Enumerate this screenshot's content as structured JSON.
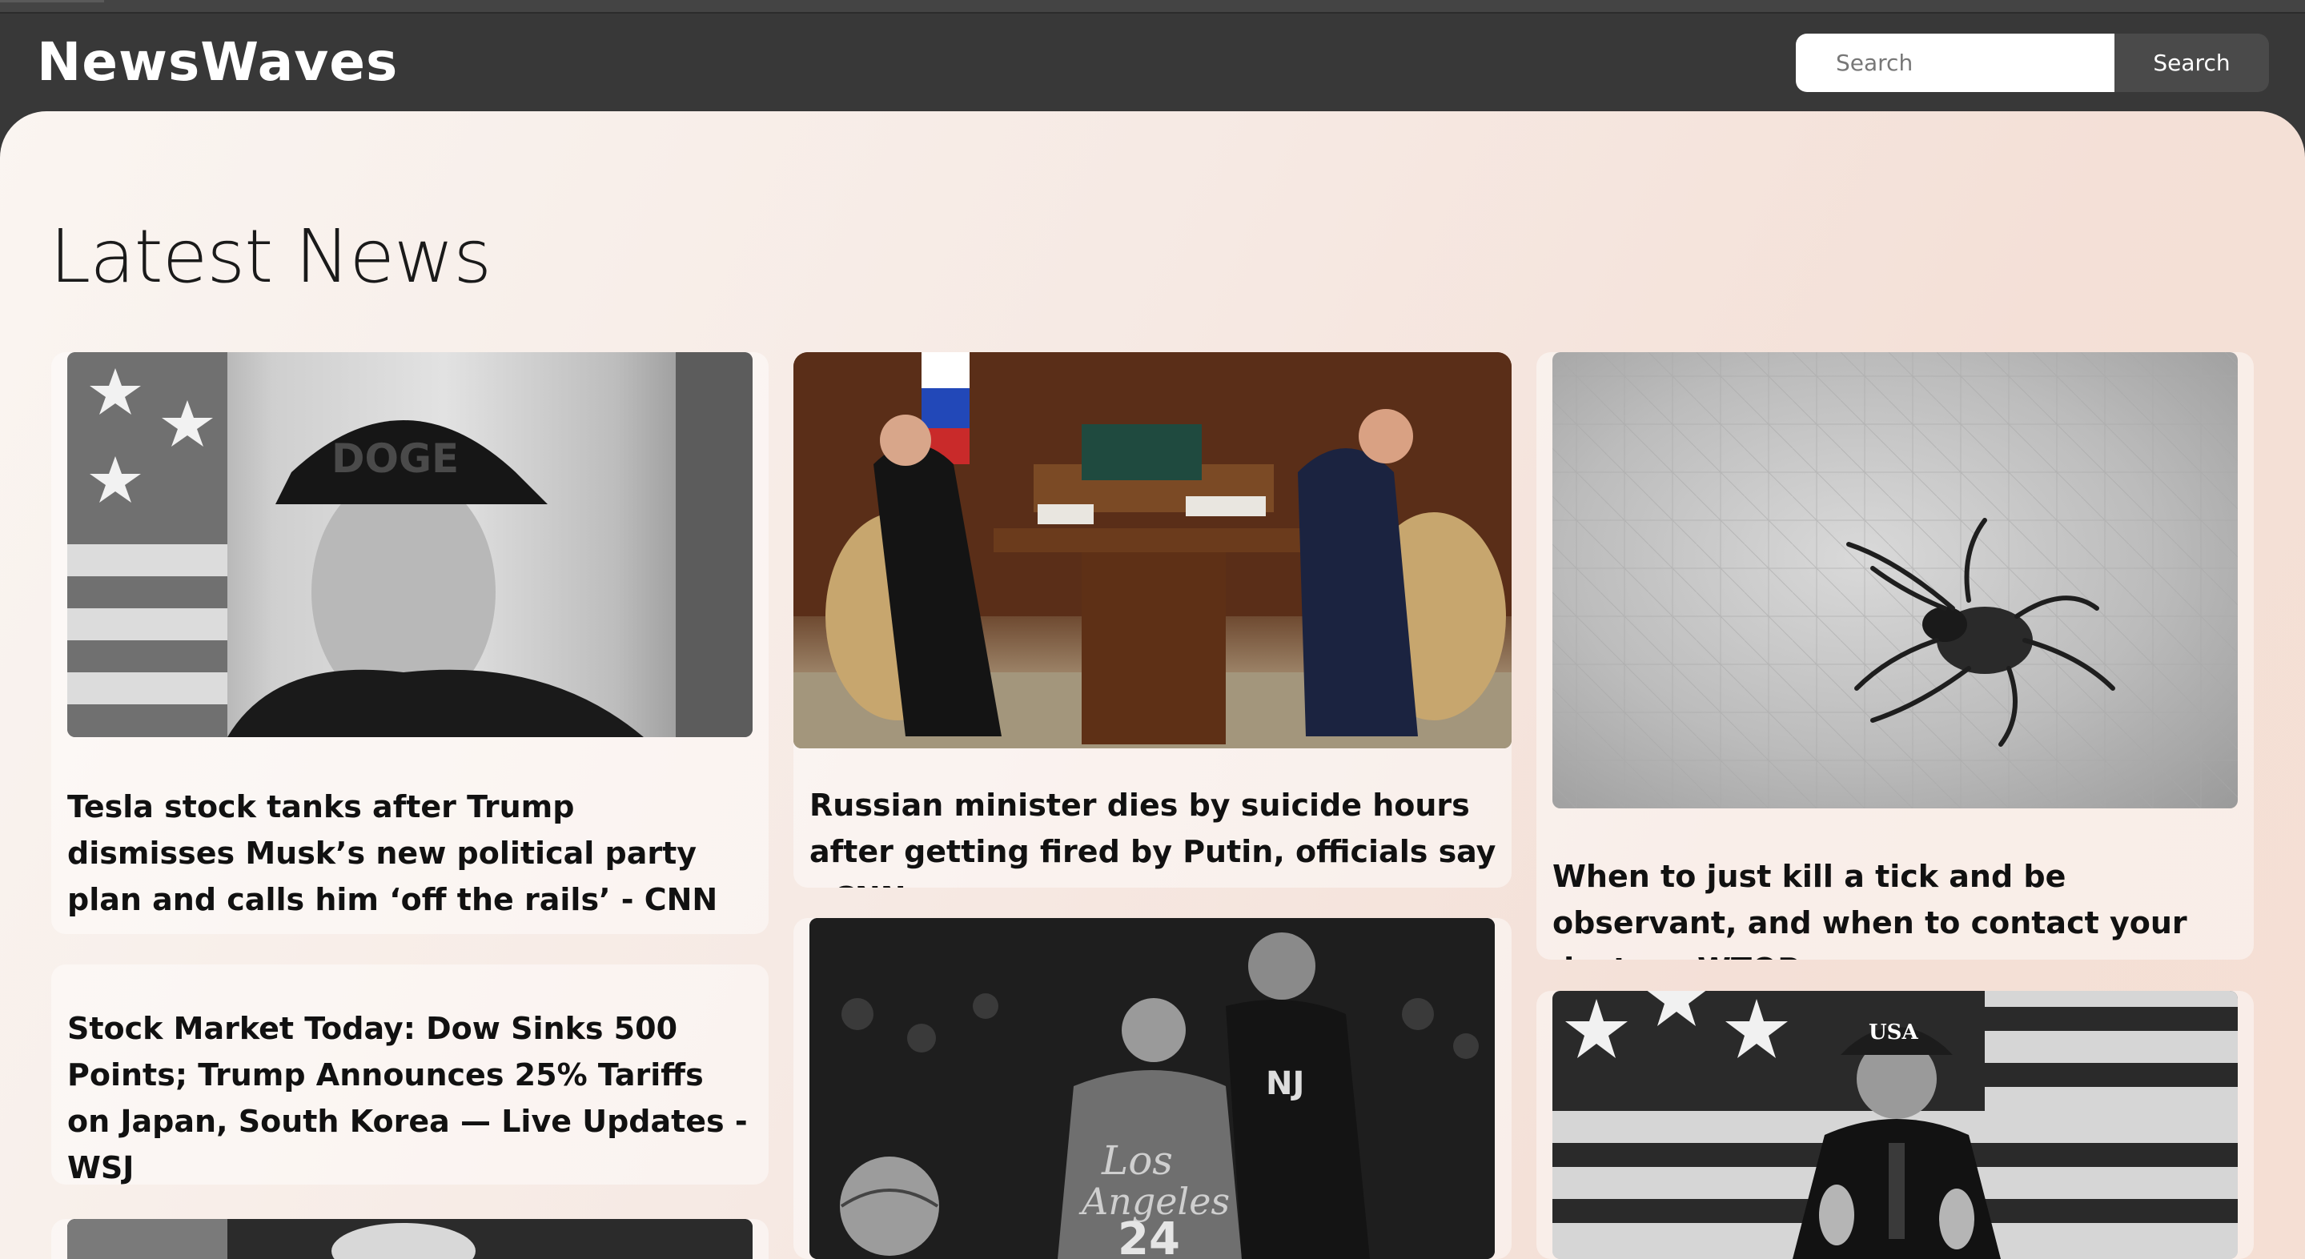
{
  "header": {
    "logo": "NewsWaves",
    "search": {
      "placeholder": "Search",
      "button_label": "Search"
    }
  },
  "main": {
    "title": "Latest News",
    "articles": [
      {
        "headline": "Tesla stock tanks after Trump dismisses Musk’s new political party plan and calls him ‘off the rails’ - CNN",
        "image": "elon-musk-photo"
      },
      {
        "headline": "Russian minister dies by suicide hours after getting fired by Putin, officials say - CNN",
        "image": "kremlin-meeting-photo"
      },
      {
        "headline": "When to just kill a tick and be observant, and when to contact your doctor - WTOP",
        "image": "tick-on-skin-photo"
      },
      {
        "headline": "Stock Market Today: Dow Sinks 500 Points; Trump Announces 25% Tariffs on Japan, South Korea — Live Updates - WSJ"
      },
      {
        "headline": "",
        "image": "basketball-players-photo"
      },
      {
        "headline": "",
        "image": "trump-usa-cap-photo"
      },
      {
        "headline": "",
        "image": "partial-photo"
      }
    ]
  }
}
